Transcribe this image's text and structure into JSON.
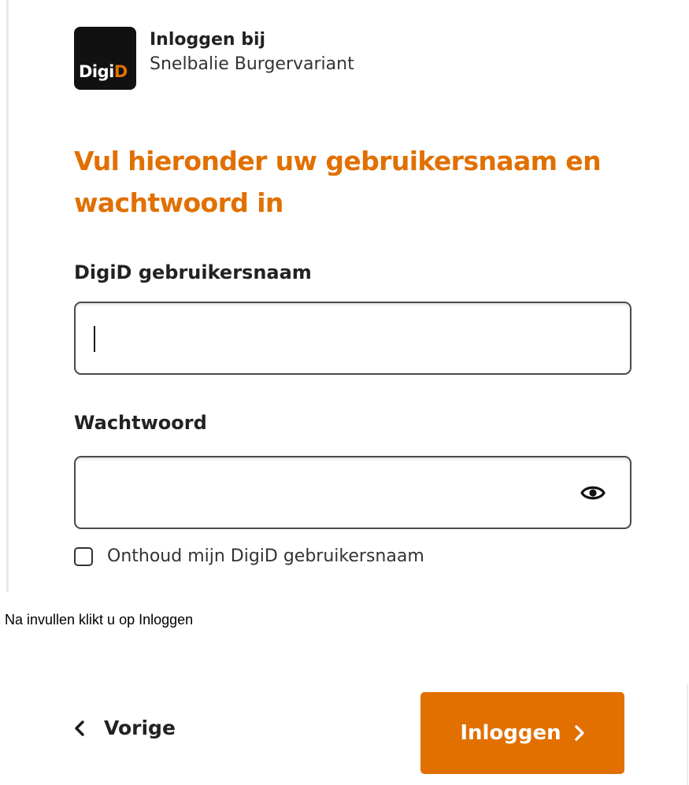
{
  "brand": {
    "logo_text_prefix": "Digi",
    "logo_text_accent": "D",
    "title": "Inloggen bij",
    "subtitle": "Snelbalie Burgervariant",
    "accent_color": "#e17000"
  },
  "form": {
    "heading": "Vul hieronder uw gebruikersnaam en wachtwoord in",
    "username_label": "DigiD gebruikersnaam",
    "username_value": "",
    "password_label": "Wachtwoord",
    "password_value": "",
    "show_password_icon": "eye-icon",
    "remember_label": "Onthoud mijn DigiD gebruikersnaam",
    "remember_checked": false
  },
  "note": "Na invullen klikt u op Inloggen",
  "actions": {
    "back_label": "Vorige",
    "back_icon": "chevron-left-icon",
    "login_label": "Inloggen",
    "login_icon": "chevron-right-icon"
  }
}
